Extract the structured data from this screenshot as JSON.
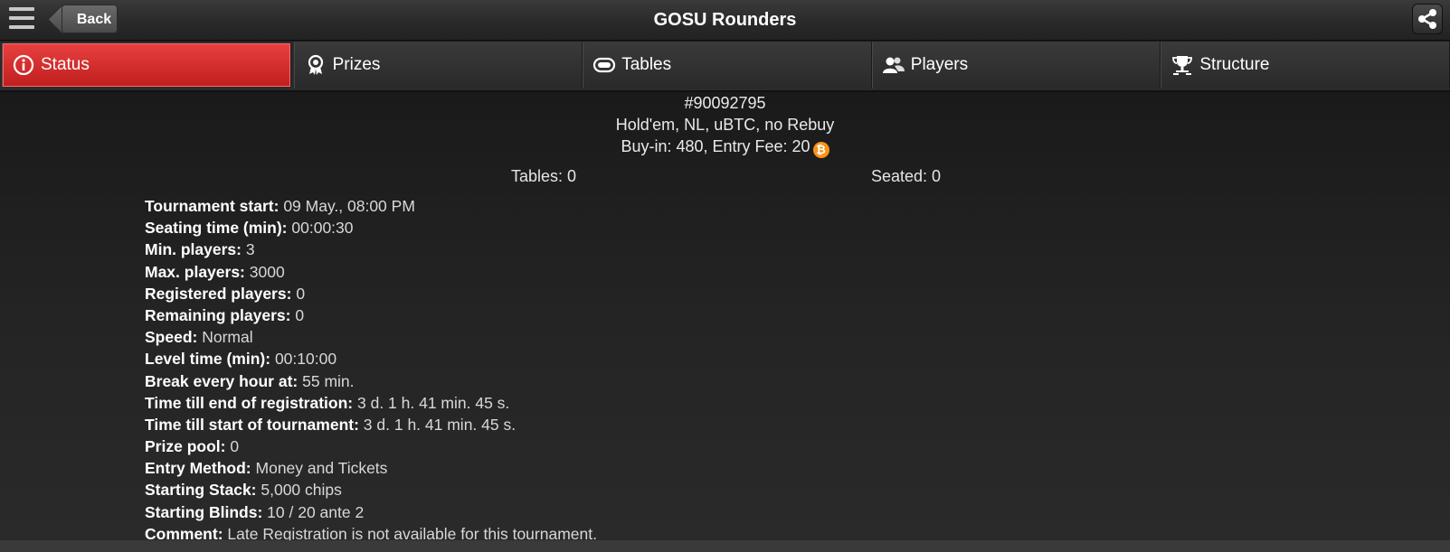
{
  "header": {
    "back_label": "Back",
    "title": "GOSU Rounders"
  },
  "tabs": [
    {
      "label": "Status",
      "icon": "info-icon",
      "active": true
    },
    {
      "label": "Prizes",
      "icon": "award-icon",
      "active": false
    },
    {
      "label": "Tables",
      "icon": "table-icon",
      "active": false
    },
    {
      "label": "Players",
      "icon": "players-icon",
      "active": false
    },
    {
      "label": "Structure",
      "icon": "trophy-icon",
      "active": false
    }
  ],
  "tournament": {
    "id": "#90092795",
    "game": "Hold'em, NL, uBTC, no Rebuy",
    "buyin": "Buy-in: 480, Entry Fee: 20",
    "coin_symbol": "₿",
    "tables": "Tables: 0",
    "seated": "Seated: 0"
  },
  "details": [
    {
      "label": "Tournament start:",
      "value": "09 May., 08:00 PM"
    },
    {
      "label": "Seating time (min):",
      "value": "00:00:30"
    },
    {
      "label": "Min. players:",
      "value": "3"
    },
    {
      "label": "Max. players:",
      "value": "3000"
    },
    {
      "label": "Registered players:",
      "value": "0"
    },
    {
      "label": "Remaining players:",
      "value": "0"
    },
    {
      "label": "Speed:",
      "value": "Normal"
    },
    {
      "label": "Level time (min):",
      "value": "00:10:00"
    },
    {
      "label": "Break every hour at:",
      "value": "55 min."
    },
    {
      "label": "Time till end of registration:",
      "value": "3 d. 1 h. 41 min. 45 s."
    },
    {
      "label": "Time till start of tournament:",
      "value": "3 d. 1 h. 41 min. 45 s."
    },
    {
      "label": "Prize pool:",
      "value": "0"
    },
    {
      "label": "Entry Method:",
      "value": "Money and Tickets"
    },
    {
      "label": "Starting Stack:",
      "value": "5,000 chips"
    },
    {
      "label": "Starting Blinds:",
      "value": "10 / 20 ante 2"
    },
    {
      "label": "Comment:",
      "value": "Late Registration is not available for this tournament."
    }
  ],
  "colors": {
    "active_tab": "#d62a2a",
    "coin": "#f7931a",
    "background": "#1b1b1b"
  }
}
